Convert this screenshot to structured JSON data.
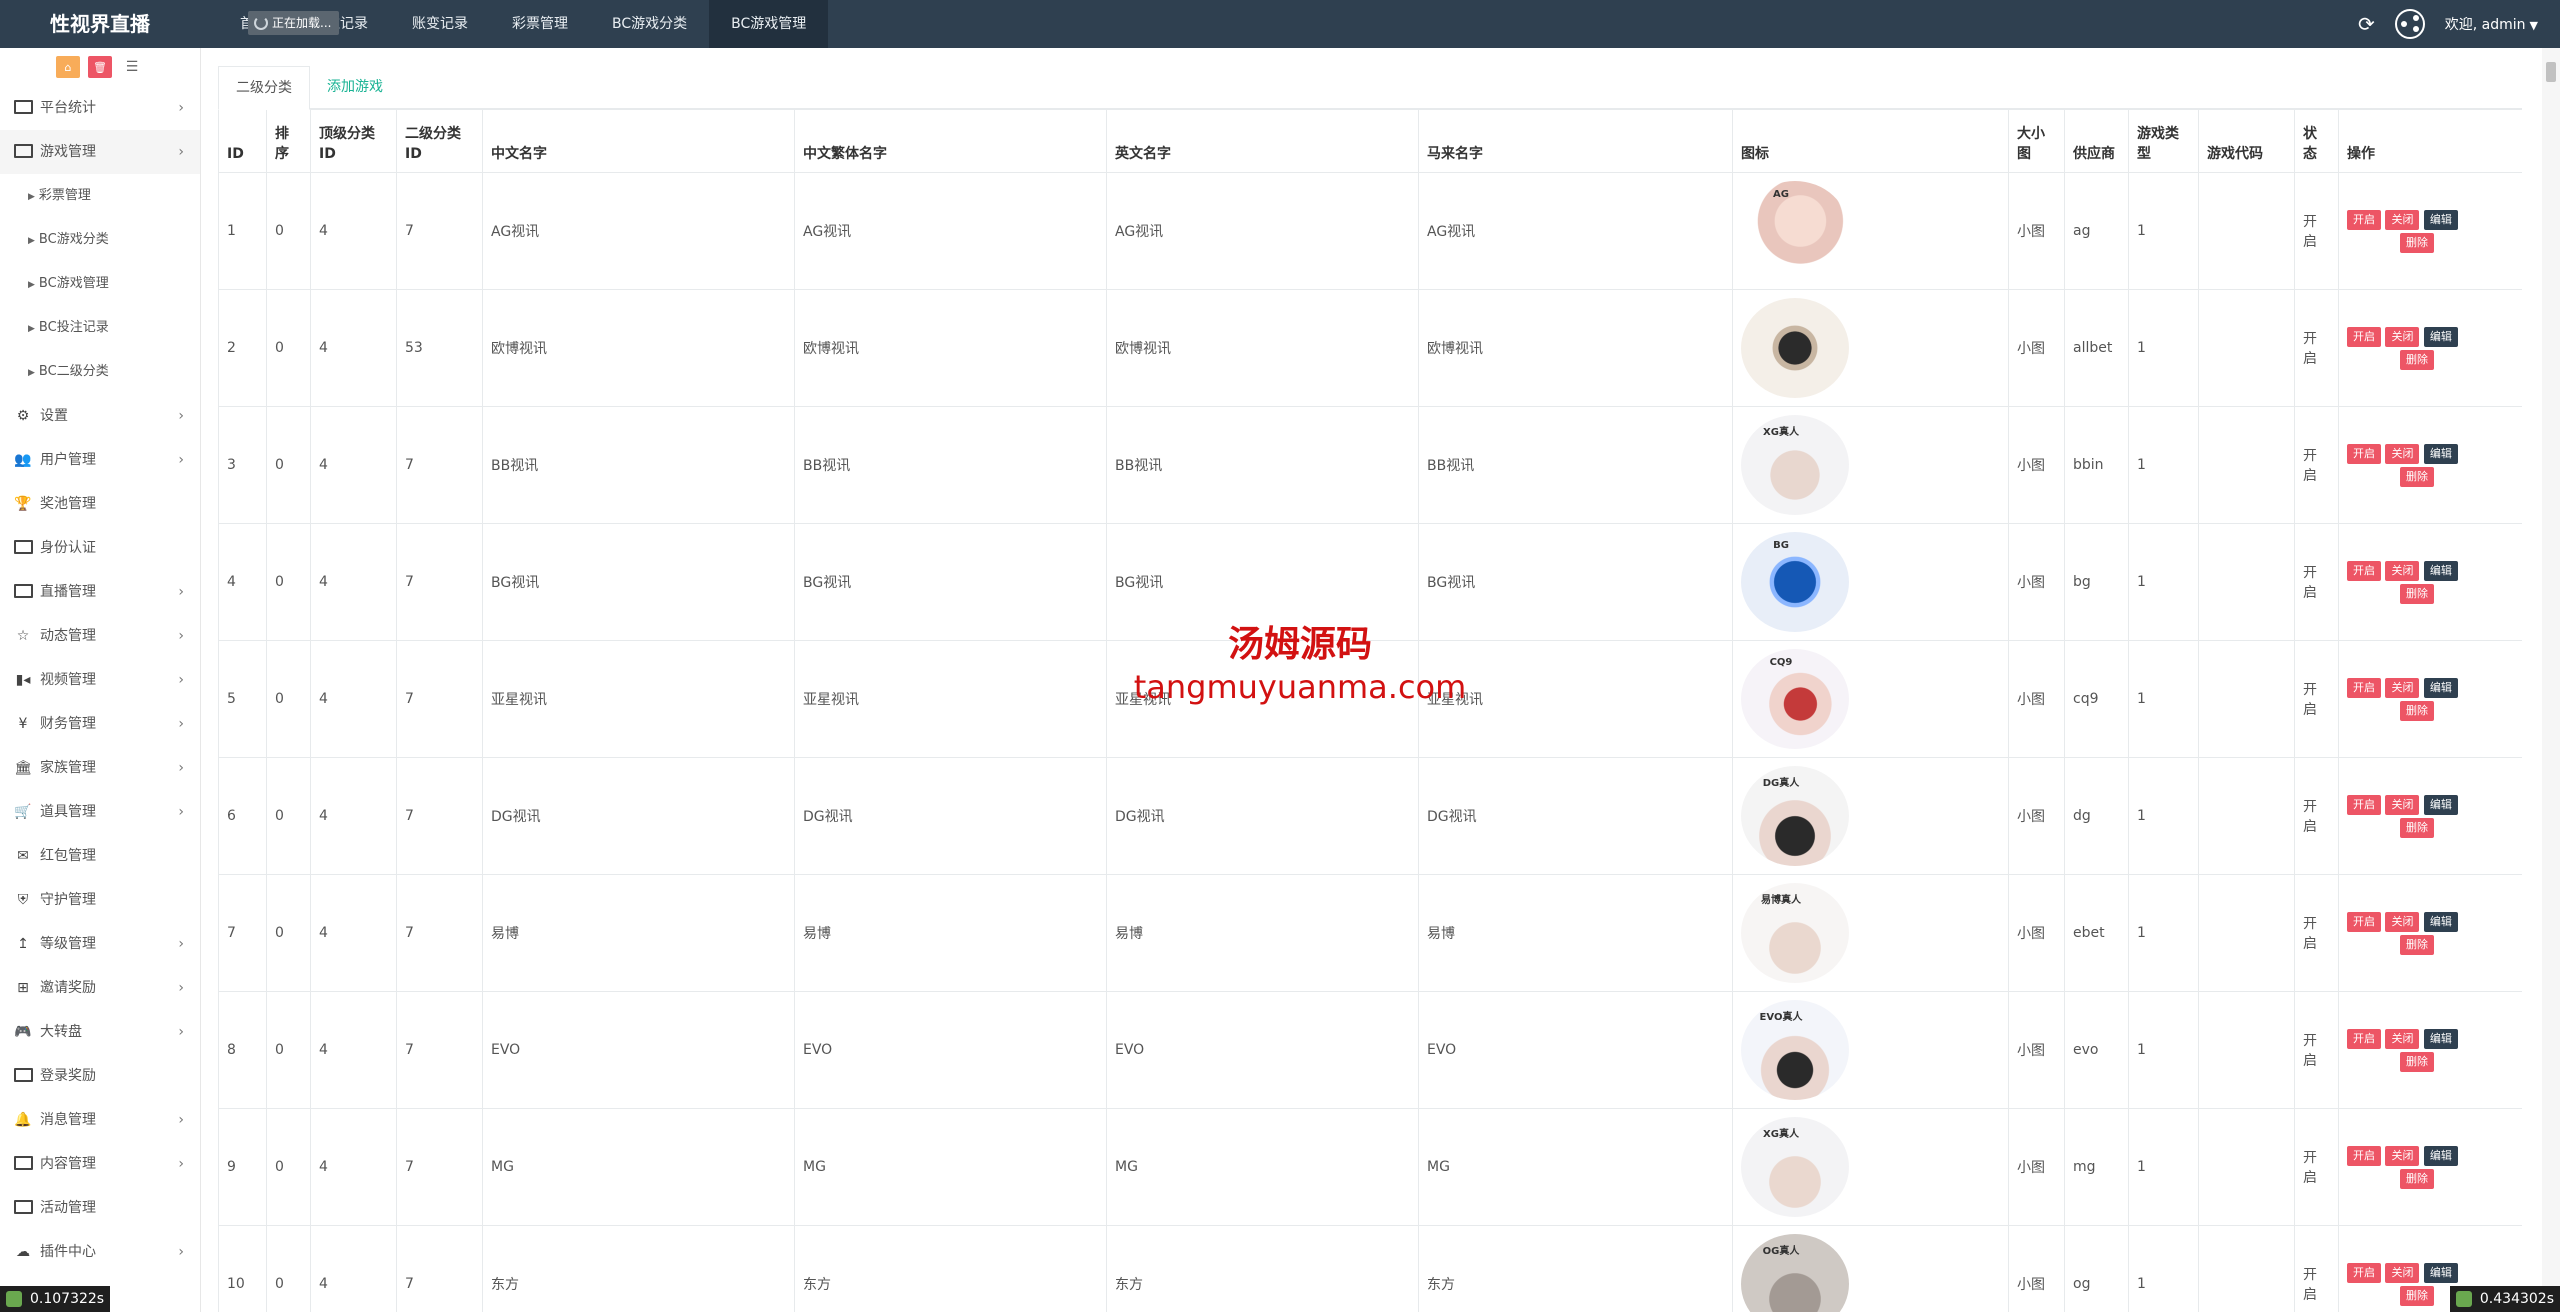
{
  "app": {
    "brand": "性视界直播",
    "nav": [
      "首页",
      "投注记录",
      "账变记录",
      "彩票管理",
      "BC游戏分类",
      "BC游戏管理"
    ],
    "loading": "正在加载...",
    "welcome": "欢迎, admin"
  },
  "sidebar": {
    "items": [
      {
        "label": "平台统计",
        "icon": "monitor-icon",
        "has_children": true
      },
      {
        "label": "游戏管理",
        "icon": "monitor-icon",
        "has_children": true,
        "expanded": true,
        "children": [
          "彩票管理",
          "BC游戏分类",
          "BC游戏管理",
          "BC投注记录",
          "BC二级分类"
        ]
      },
      {
        "label": "设置",
        "icon": "gears-icon",
        "has_children": true
      },
      {
        "label": "用户管理",
        "icon": "users-icon",
        "has_children": true
      },
      {
        "label": "奖池管理",
        "icon": "trophy-icon",
        "has_children": false
      },
      {
        "label": "身份认证",
        "icon": "monitor-icon",
        "has_children": false
      },
      {
        "label": "直播管理",
        "icon": "monitor-icon",
        "has_children": true
      },
      {
        "label": "动态管理",
        "icon": "star-icon",
        "has_children": true
      },
      {
        "label": "视频管理",
        "icon": "video-icon",
        "has_children": true
      },
      {
        "label": "财务管理",
        "icon": "yen-icon",
        "has_children": true
      },
      {
        "label": "家族管理",
        "icon": "bank-icon",
        "has_children": true
      },
      {
        "label": "道具管理",
        "icon": "cart-icon",
        "has_children": true
      },
      {
        "label": "红包管理",
        "icon": "envelope-icon",
        "has_children": false
      },
      {
        "label": "守护管理",
        "icon": "shield-icon",
        "has_children": false
      },
      {
        "label": "等级管理",
        "icon": "level-icon",
        "has_children": true
      },
      {
        "label": "邀请奖励",
        "icon": "sitemap-icon",
        "has_children": true
      },
      {
        "label": "大转盘",
        "icon": "gamepad-icon",
        "has_children": true
      },
      {
        "label": "登录奖励",
        "icon": "monitor-icon",
        "has_children": false
      },
      {
        "label": "消息管理",
        "icon": "bell-icon",
        "has_children": true
      },
      {
        "label": "内容管理",
        "icon": "monitor-icon",
        "has_children": true
      },
      {
        "label": "活动管理",
        "icon": "monitor-icon",
        "has_children": false
      },
      {
        "label": "插件中心",
        "icon": "cloud-icon",
        "has_children": true
      }
    ]
  },
  "tabs": [
    {
      "label": "二级分类",
      "active": true
    },
    {
      "label": "添加游戏",
      "active": false
    }
  ],
  "table": {
    "headers": [
      "ID",
      "排序",
      "顶级分类ID",
      "二级分类ID",
      "中文名字",
      "中文繁体名字",
      "英文名字",
      "马来名字",
      "图标",
      "大小图",
      "供应商",
      "游戏类型",
      "游戏代码",
      "状态",
      "操作"
    ],
    "rows": [
      {
        "id": "1",
        "sort": "0",
        "top": "4",
        "sub": "7",
        "cn": "AG视讯",
        "tw": "AG视讯",
        "en": "AG视讯",
        "ms": "AG视讯",
        "size": "小图",
        "vendor": "ag",
        "type": "1",
        "code": "",
        "status": "开启",
        "icon_label": "AG"
      },
      {
        "id": "2",
        "sort": "0",
        "top": "4",
        "sub": "53",
        "cn": "欧博视讯",
        "tw": "欧博视讯",
        "en": "欧博视讯",
        "ms": "欧博视讯",
        "size": "小图",
        "vendor": "allbet",
        "type": "1",
        "code": "",
        "status": "开启",
        "icon_label": ""
      },
      {
        "id": "3",
        "sort": "0",
        "top": "4",
        "sub": "7",
        "cn": "BB视讯",
        "tw": "BB视讯",
        "en": "BB视讯",
        "ms": "BB视讯",
        "size": "小图",
        "vendor": "bbin",
        "type": "1",
        "code": "",
        "status": "开启",
        "icon_label": "XG真人"
      },
      {
        "id": "4",
        "sort": "0",
        "top": "4",
        "sub": "7",
        "cn": "BG视讯",
        "tw": "BG视讯",
        "en": "BG视讯",
        "ms": "BG视讯",
        "size": "小图",
        "vendor": "bg",
        "type": "1",
        "code": "",
        "status": "开启",
        "icon_label": "BG"
      },
      {
        "id": "5",
        "sort": "0",
        "top": "4",
        "sub": "7",
        "cn": "亚星视讯",
        "tw": "亚星视讯",
        "en": "亚星视讯",
        "ms": "亚星视讯",
        "size": "小图",
        "vendor": "cq9",
        "type": "1",
        "code": "",
        "status": "开启",
        "icon_label": "CQ9"
      },
      {
        "id": "6",
        "sort": "0",
        "top": "4",
        "sub": "7",
        "cn": "DG视讯",
        "tw": "DG视讯",
        "en": "DG视讯",
        "ms": "DG视讯",
        "size": "小图",
        "vendor": "dg",
        "type": "1",
        "code": "",
        "status": "开启",
        "icon_label": "DG真人"
      },
      {
        "id": "7",
        "sort": "0",
        "top": "4",
        "sub": "7",
        "cn": "易博",
        "tw": "易博",
        "en": "易博",
        "ms": "易博",
        "size": "小图",
        "vendor": "ebet",
        "type": "1",
        "code": "",
        "status": "开启",
        "icon_label": "易博真人"
      },
      {
        "id": "8",
        "sort": "0",
        "top": "4",
        "sub": "7",
        "cn": "EVO",
        "tw": "EVO",
        "en": "EVO",
        "ms": "EVO",
        "size": "小图",
        "vendor": "evo",
        "type": "1",
        "code": "",
        "status": "开启",
        "icon_label": "EVO真人"
      },
      {
        "id": "9",
        "sort": "0",
        "top": "4",
        "sub": "7",
        "cn": "MG",
        "tw": "MG",
        "en": "MG",
        "ms": "MG",
        "size": "小图",
        "vendor": "mg",
        "type": "1",
        "code": "",
        "status": "开启",
        "icon_label": "XG真人"
      },
      {
        "id": "10",
        "sort": "0",
        "top": "4",
        "sub": "7",
        "cn": "东方",
        "tw": "东方",
        "en": "东方",
        "ms": "东方",
        "size": "小图",
        "vendor": "og",
        "type": "1",
        "code": "",
        "status": "开启",
        "icon_label": "OG真人"
      }
    ],
    "actions": {
      "open": "开启",
      "close": "关闭",
      "edit": "编辑",
      "delete": "删除"
    }
  },
  "watermark": {
    "cn": "汤姆源码",
    "en": "tangmuyuanma.com"
  },
  "timers": {
    "left": "0.107322s",
    "right": "0.434302s"
  },
  "colors": {
    "header": "#2f4050",
    "accent": "#1ab394",
    "danger": "#ed5565",
    "warning": "#f8ac59"
  }
}
